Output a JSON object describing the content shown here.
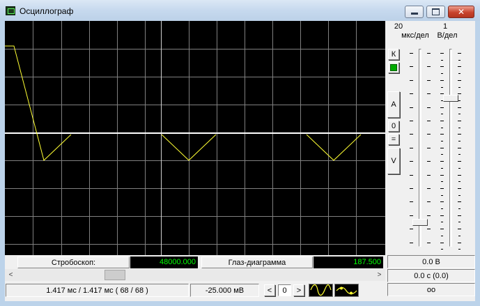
{
  "window": {
    "title": "Осциллограф"
  },
  "timebase": {
    "value": "20",
    "unit": "мкс/дел"
  },
  "voltscale": {
    "value": "1",
    "unit": "В/дел"
  },
  "side_buttons": {
    "k": "К",
    "a": "A",
    "zero": "0",
    "eq": "=",
    "v": "V"
  },
  "readouts": {
    "voltage": "0.0 В",
    "time": "0.0 с (0.0)",
    "infinity": "oo"
  },
  "stroboscope": {
    "label": "Стробоскоп:",
    "value": "48000.000"
  },
  "eye_diagram": {
    "label": "Глаз-диаграмма",
    "value": "187.500"
  },
  "status": {
    "time_info": "1.417 мс / 1.417 мс ( 68 / 68 )",
    "level": "-25.000 мВ"
  },
  "nav": {
    "prev": "<",
    "counter": "0",
    "next": ">"
  },
  "icons": {
    "sine_mode": "sine-wave-icon",
    "dot_mode": "dotted-wave-icon"
  },
  "colors": {
    "trace": "#ffff33",
    "baseline": "#ffffff",
    "grid": "#808080",
    "readout_text": "#00ff00"
  }
}
